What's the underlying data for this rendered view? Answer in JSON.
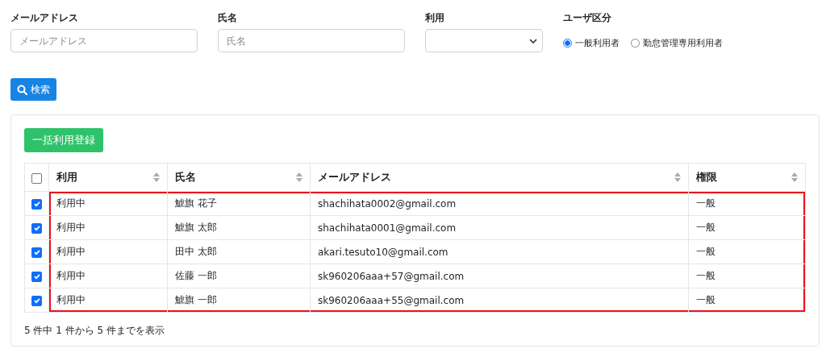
{
  "filters": {
    "email": {
      "label": "メールアドレス",
      "placeholder": "メールアドレス"
    },
    "name": {
      "label": "氏名",
      "placeholder": "氏名"
    },
    "usage": {
      "label": "利用"
    },
    "user_type": {
      "label": "ユーザ区分",
      "options": [
        {
          "label": "一般利用者",
          "selected": true
        },
        {
          "label": "勤怠管理専用利用者",
          "selected": false
        }
      ]
    }
  },
  "search_button": "検索",
  "bulk_button": "一括利用登録",
  "table": {
    "select_all": {
      "checked": false
    },
    "columns": [
      "利用",
      "氏名",
      "メールアドレス",
      "権限"
    ],
    "rows": [
      {
        "checked": true,
        "highlighted": true,
        "cells": [
          "利用中",
          "鯱旗 花子",
          "shachihata0002@gmail.com",
          "一般"
        ]
      },
      {
        "checked": true,
        "highlighted": true,
        "cells": [
          "利用中",
          "鯱旗 太郎",
          "shachihata0001@gmail.com",
          "一般"
        ]
      },
      {
        "checked": true,
        "highlighted": true,
        "cells": [
          "利用中",
          "田中 太郎",
          "akari.tesuto10@gmail.com",
          "一般"
        ]
      },
      {
        "checked": true,
        "highlighted": true,
        "cells": [
          "利用中",
          "佐藤 一郎",
          "sk960206aaa+57@gmail.com",
          "一般"
        ]
      },
      {
        "checked": true,
        "highlighted": true,
        "cells": [
          "利用中",
          "鯱旗 一郎",
          "sk960206aaa+55@gmail.com",
          "一般"
        ]
      }
    ]
  },
  "footer": "5 件中 1 件から 5 件までを表示"
}
